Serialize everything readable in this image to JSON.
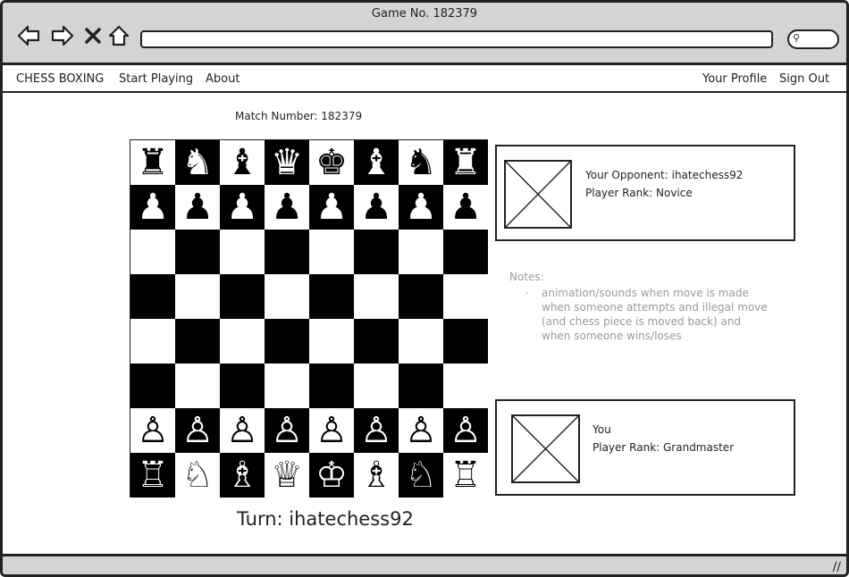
{
  "window": {
    "title": "Game No. 182379"
  },
  "menu": {
    "brand": "CHESS BOXING",
    "start": "Start Playing",
    "about": "About",
    "profile": "Your Profile",
    "signout": "Sign Out"
  },
  "match": {
    "label": "Match Number: 182379"
  },
  "board": {
    "rows": [
      [
        "♜",
        "♞",
        "♝",
        "♛",
        "♚",
        "♝",
        "♞",
        "♜"
      ],
      [
        "♟",
        "♟",
        "♟",
        "♟",
        "♟",
        "♟",
        "♟",
        "♟"
      ],
      [
        "",
        "",
        "",
        "",
        "",
        "",
        "",
        ""
      ],
      [
        "",
        "",
        "",
        "",
        "",
        "",
        "",
        ""
      ],
      [
        "",
        "",
        "",
        "",
        "",
        "",
        "",
        ""
      ],
      [
        "",
        "",
        "",
        "",
        "",
        "",
        "",
        ""
      ],
      [
        "♙",
        "♙",
        "♙",
        "♙",
        "♙",
        "♙",
        "♙",
        "♙"
      ],
      [
        "♖",
        "♘",
        "♗",
        "♕",
        "♔",
        "♗",
        "♘",
        "♖"
      ]
    ]
  },
  "opponent": {
    "name": "Your Opponent: ihatechess92",
    "rank": "Player Rank: Novice"
  },
  "you": {
    "name": "You",
    "rank": "Player Rank: Grandmaster"
  },
  "notes": {
    "heading": "Notes:",
    "items": [
      "animation/sounds when move is made when someone attempts and illegal move (and chess piece is moved back) and when someone wins/loses"
    ]
  },
  "turn": {
    "label": "Turn: ihatechess92"
  }
}
